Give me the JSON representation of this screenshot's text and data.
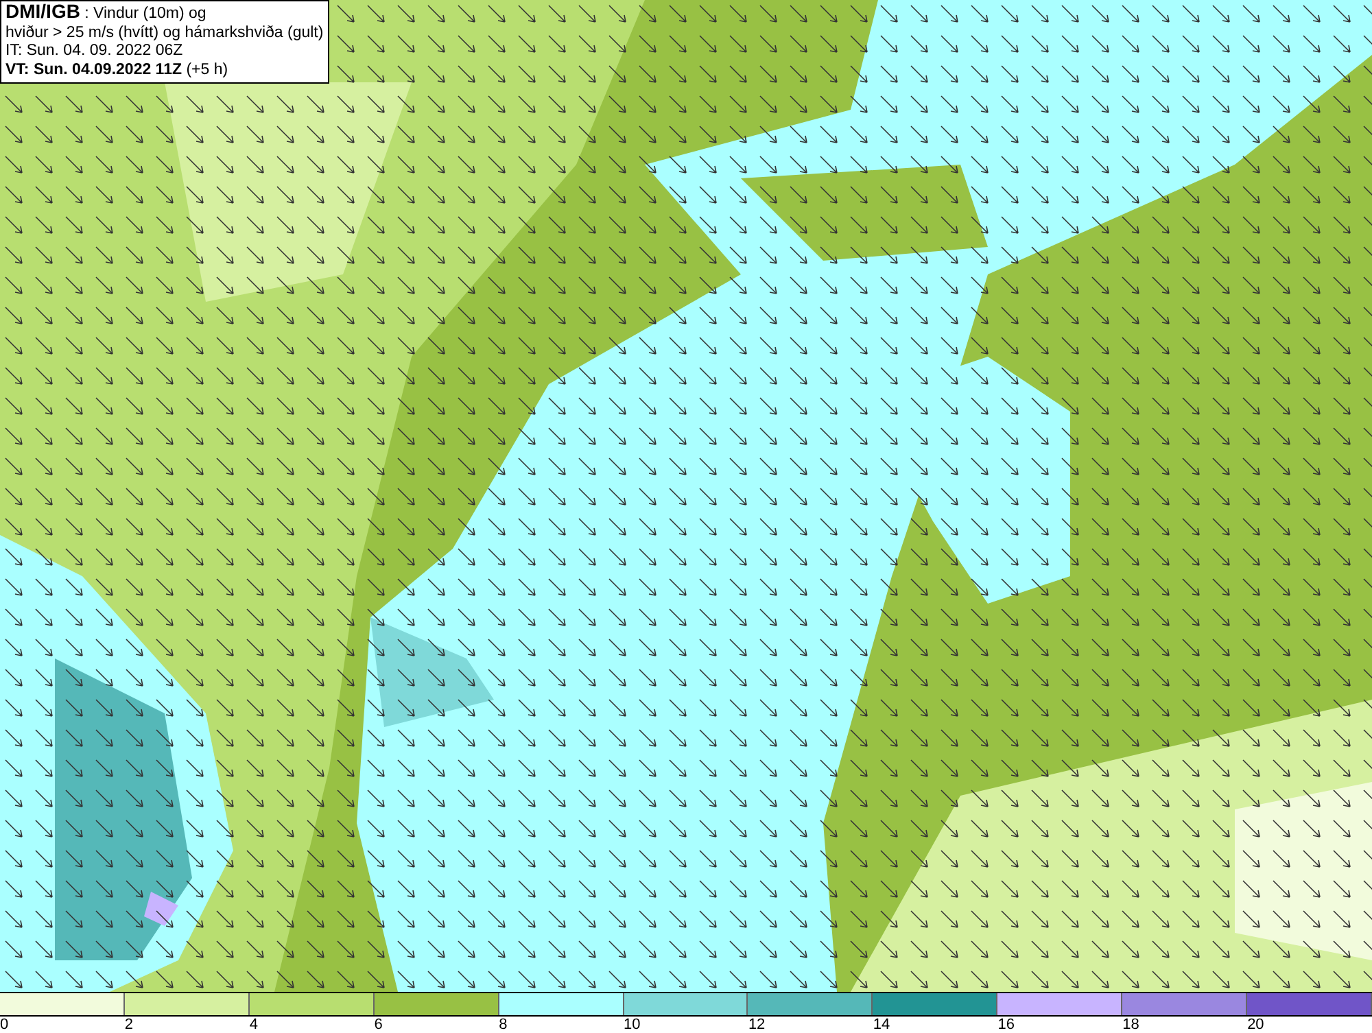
{
  "info_box": {
    "lines": [
      "**DMI/IGB** : Vindur (10m) og",
      "hviður > 25 m/s (hvítt) og hámarkshviða (gult)",
      "IT: Sun. 04. 09. 2022 06Z",
      "**VT: Sun. 04.09.2022 11Z** (+5 h)"
    ]
  },
  "legend": {
    "bins": [
      {
        "color": "#f2fbdc",
        "label": "0"
      },
      {
        "color": "#d6f0a0",
        "label": "2"
      },
      {
        "color": "#b8de70",
        "label": "4"
      },
      {
        "color": "#98c144",
        "label": "6"
      },
      {
        "color": "#aaffff",
        "label": "8"
      },
      {
        "color": "#7fd9d9",
        "label": "10"
      },
      {
        "color": "#55b8b8",
        "label": "12"
      },
      {
        "color": "#229494",
        "label": "14"
      },
      {
        "color": "#c8b4ff",
        "label": "16"
      },
      {
        "color": "#9a87e0",
        "label": "18"
      },
      {
        "color": "#7055c8",
        "label": "20"
      }
    ]
  }
}
